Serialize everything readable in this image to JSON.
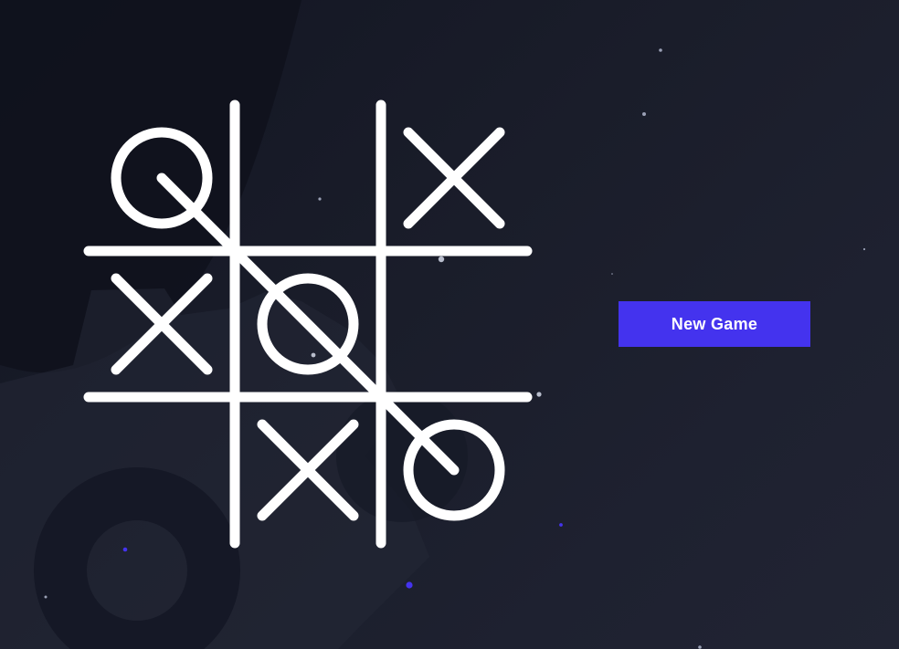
{
  "board": {
    "cells": [
      "O",
      "",
      "X",
      "X",
      "O",
      "",
      "",
      "X",
      "O"
    ],
    "winner": "O",
    "winning_line": "main-diagonal"
  },
  "controls": {
    "new_game_label": "New Game"
  },
  "colors": {
    "background": "#141724",
    "marks": "#ffffff",
    "accent": "#4433ee"
  }
}
